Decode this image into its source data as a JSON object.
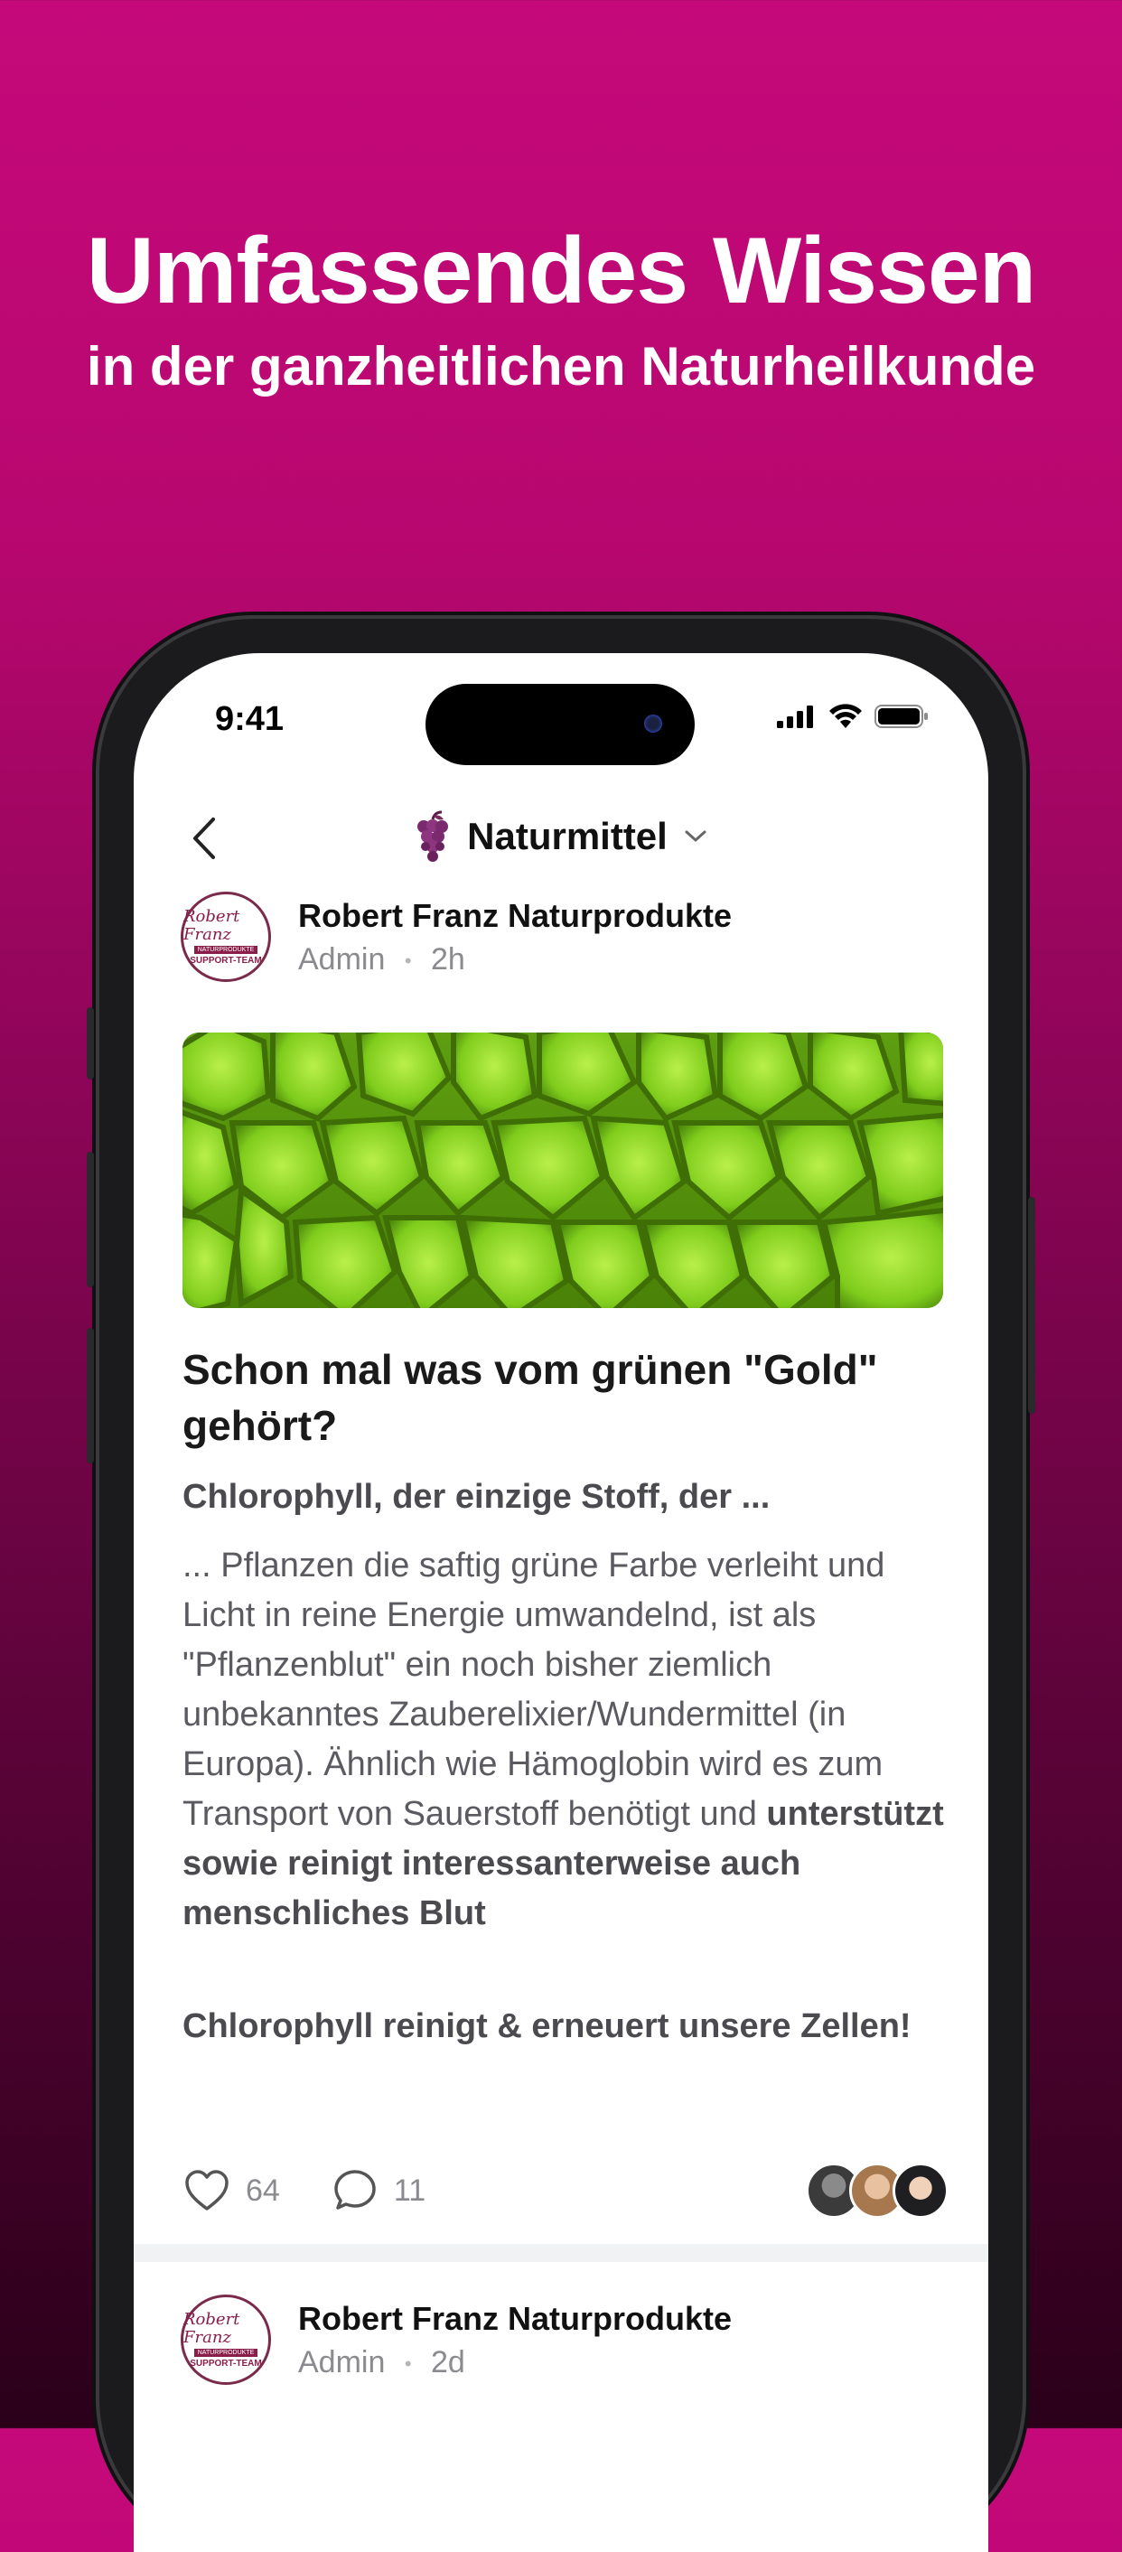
{
  "promo": {
    "headline": "Umfassendes Wissen",
    "subline": "in der ganzheitlichen Naturheilkunde"
  },
  "status_bar": {
    "time": "9:41"
  },
  "nav": {
    "title": "Naturmittel",
    "icon": "grapes-icon"
  },
  "posts": [
    {
      "author": "Robert Franz Naturprodukte",
      "role": "Admin",
      "separator": "•",
      "age": "2h",
      "logo": {
        "signature": "Robert Franz",
        "band": "NATURPRODUKTE",
        "team": "SUPPORT-TEAM"
      },
      "title": "Schon mal was vom grünen \"Gold\" gehört?",
      "subtitle": "Chlorophyll, der einzige Stoff, der ...",
      "body_plain": "... Pflanzen die saftig grüne Farbe verleiht und Licht in reine Energie umwandelnd, ist als \"Pflanzenblut\" ein noch bisher ziemlich unbekanntes Zauberelixier/Wundermittel (in Europa). Ähnlich wie Hämoglobin wird es zum Transport von Sauerstoff benötigt und ",
      "body_bold": "unterstützt sowie reinigt interessanterweise auch menschliches Blut",
      "closing": "Chlorophyll reinigt & erneuert unsere Zellen!",
      "likes": "64",
      "comments": "11"
    },
    {
      "author": "Robert Franz Naturprodukte",
      "role": "Admin",
      "separator": "•",
      "age": "2d",
      "logo": {
        "signature": "Robert Franz",
        "band": "NATURPRODUKTE",
        "team": "SUPPORT-TEAM"
      }
    }
  ],
  "colors": {
    "accent": "#c5097a",
    "logo": "#8a1e4a",
    "leaf_green": "#6fbf1a"
  }
}
